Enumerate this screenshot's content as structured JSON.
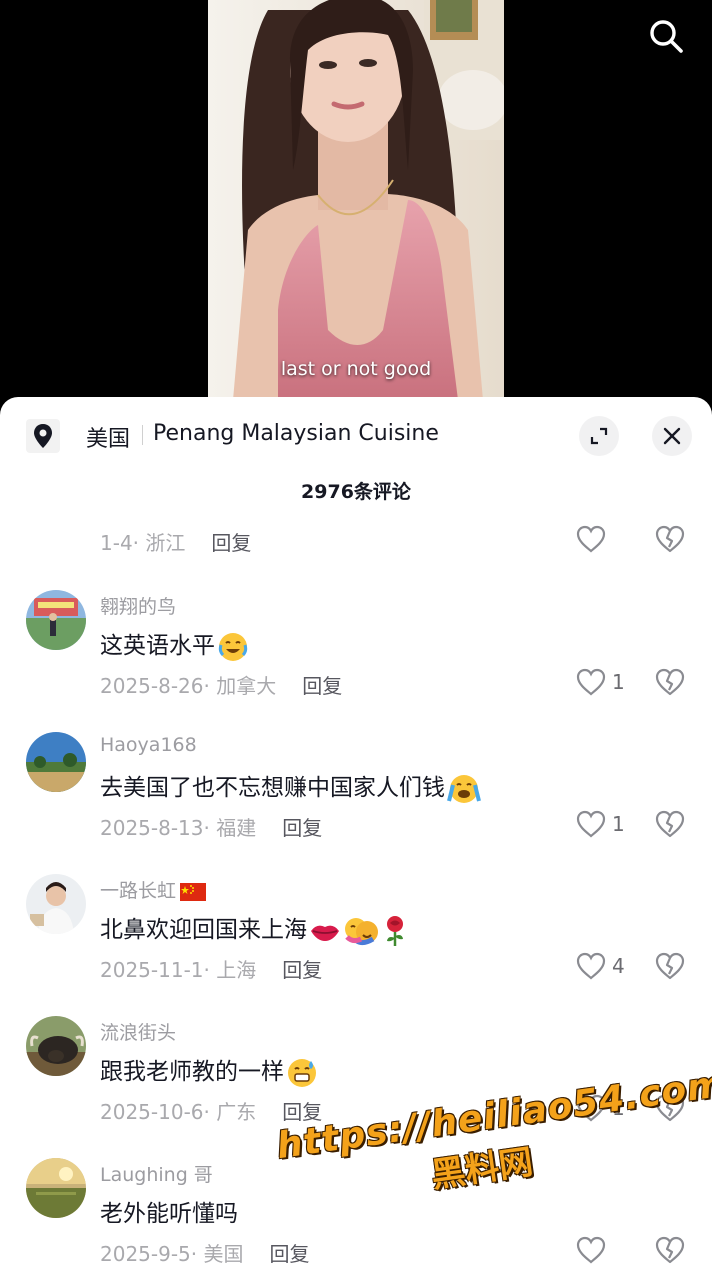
{
  "video": {
    "caption": "last or not good"
  },
  "header": {
    "region": "美国",
    "location_name": "Penang Malaysian Cuisine"
  },
  "comment_count_label": "2976条评论",
  "comments": [
    {
      "partial": true,
      "date": "1-4",
      "place": "浙江",
      "reply_label": "回复",
      "likes": ""
    },
    {
      "author": "翱翔的鸟",
      "text": "这英语水平",
      "emoji": [
        "crying-laughing-emoji"
      ],
      "date": "2025-8-26",
      "place": "加拿大",
      "reply_label": "回复",
      "likes": "1"
    },
    {
      "author": "Haoya168",
      "text": "去美国了也不忘想赚中国家人们钱",
      "emoji": [
        "crying-emoji"
      ],
      "date": "2025-8-13",
      "place": "福建",
      "reply_label": "回复",
      "likes": "1"
    },
    {
      "author": "一路长虹",
      "author_flag": "china-flag-icon",
      "text": "北鼻欢迎回国来上海",
      "emoji": [
        "kiss-lips-emoji",
        "hug-emoji",
        "rose-emoji"
      ],
      "date": "2025-11-1",
      "place": "上海",
      "reply_label": "回复",
      "likes": "4"
    },
    {
      "author": "流浪街头",
      "text": "跟我老师教的一样",
      "emoji": [
        "grin-sweat-emoji"
      ],
      "date": "2025-10-6",
      "place": "广东",
      "reply_label": "回复",
      "likes": "1"
    },
    {
      "author": "Laughing 哥",
      "text": "老外能听懂吗",
      "emoji": [],
      "date": "2025-9-5",
      "place": "美国",
      "reply_label": "回复",
      "likes": ""
    }
  ],
  "watermark": {
    "url": "https://heiliao54.com",
    "name": "黑料网"
  },
  "colors": {
    "accent_watermark": "#f4a21a",
    "text_primary": "#161823",
    "text_secondary": "#a9a9ad"
  }
}
